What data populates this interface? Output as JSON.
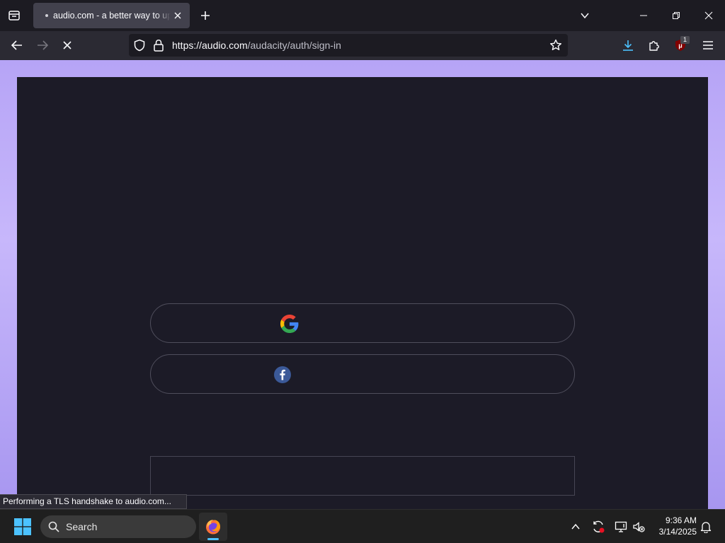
{
  "browser": {
    "tab": {
      "title": "audio.com - a better way to upload"
    },
    "url": {
      "domain": "https://audio.com",
      "path": "/audacity/auth/sign-in"
    },
    "extension_badge": "1"
  },
  "page": {
    "sso_buttons": [
      {
        "provider": "google"
      },
      {
        "provider": "facebook"
      }
    ]
  },
  "status_text": "Performing a TLS handshake to audio.com...",
  "taskbar": {
    "search_label": "Search",
    "time": "9:36 AM",
    "date": "3/14/2025"
  },
  "colors": {
    "accent": "#4cc2ff",
    "page_background": "#b6a4f6",
    "card_background": "#1c1b27"
  }
}
